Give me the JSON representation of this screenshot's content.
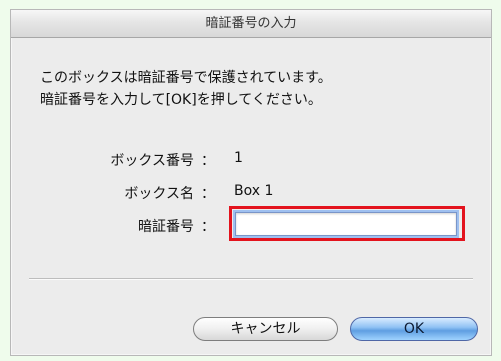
{
  "dialog": {
    "title": "暗証番号の入力",
    "message_line1": "このボックスは暗証番号で保護されています。",
    "message_line2": "暗証番号を入力して[OK]を押してください。"
  },
  "fields": {
    "box_number_label": "ボックス番号",
    "box_number_value": "1",
    "box_name_label": "ボックス名",
    "box_name_value": "Box 1",
    "pin_label": "暗証番号",
    "colon": "：",
    "pin_value": ""
  },
  "buttons": {
    "cancel": "キャンセル",
    "ok": "OK"
  },
  "colors": {
    "highlight": "#e3131d",
    "ok_button": "#5f9ee2",
    "background": "#ececec"
  }
}
